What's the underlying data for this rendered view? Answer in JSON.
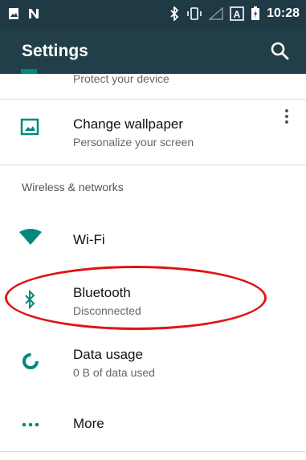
{
  "status_bar": {
    "time": "10:28",
    "icons": [
      "photo-icon",
      "n-notification-icon",
      "bluetooth-icon",
      "vibrate-icon",
      "no-signal-icon",
      "a-badge-icon",
      "battery-icon"
    ]
  },
  "app_bar": {
    "title": "Settings",
    "search_icon": "search-icon"
  },
  "items": {
    "security": {
      "subtitle": "Protect your device"
    },
    "wallpaper": {
      "title": "Change wallpaper",
      "subtitle": "Personalize your screen",
      "icon": "wallpaper-icon"
    },
    "section_wireless": "Wireless & networks",
    "wifi": {
      "title": "Wi-Fi",
      "icon": "wifi-icon"
    },
    "bluetooth": {
      "title": "Bluetooth",
      "subtitle": "Disconnected",
      "icon": "bluetooth-icon"
    },
    "data_usage": {
      "title": "Data usage",
      "subtitle": "0 B of data used",
      "icon": "data-usage-icon"
    },
    "more": {
      "title": "More",
      "icon": "more-dots-icon"
    }
  },
  "colors": {
    "accent": "#00897b",
    "status_bar": "#1f3a45",
    "app_bar": "#223f49",
    "highlight": "#e01414"
  }
}
